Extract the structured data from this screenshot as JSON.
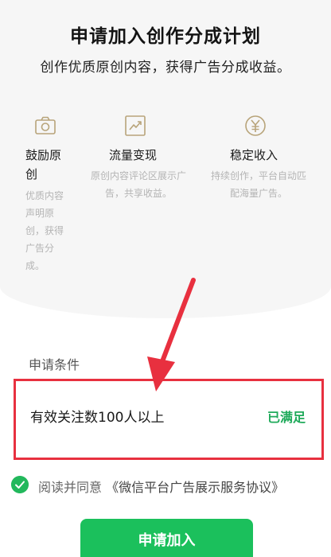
{
  "header": {
    "title": "申请加入创作分成计划",
    "subtitle": "创作优质原创内容，获得广告分成收益。"
  },
  "features": [
    {
      "icon": "camera-icon",
      "title_lines": [
        "鼓励原",
        "创"
      ],
      "desc_lines": [
        "优质内容",
        "声明原",
        "创，获得",
        "广告分",
        "成。"
      ]
    },
    {
      "icon": "chart-icon",
      "title_lines": [
        "流量变现"
      ],
      "desc_lines": [
        "原创内容评论区展示广",
        "告，共享收益。"
      ]
    },
    {
      "icon": "yen-icon",
      "title_lines": [
        "稳定收入"
      ],
      "desc_lines": [
        "持续创作，平台自动匹",
        "配海量广告。"
      ]
    }
  ],
  "conditions": {
    "label": "申请条件",
    "items": [
      {
        "text": "有效关注数100人以上",
        "status": "已满足"
      }
    ]
  },
  "agreement": {
    "prefix": "阅读并同意",
    "link": "《微信平台广告展示服务协议》"
  },
  "apply_button": {
    "label": "申请加入"
  },
  "colors": {
    "brand_green": "#1bc05c",
    "status_green": "#1faa5a",
    "icon_gold": "#b8a47a",
    "annotation_red": "#e8303f"
  }
}
